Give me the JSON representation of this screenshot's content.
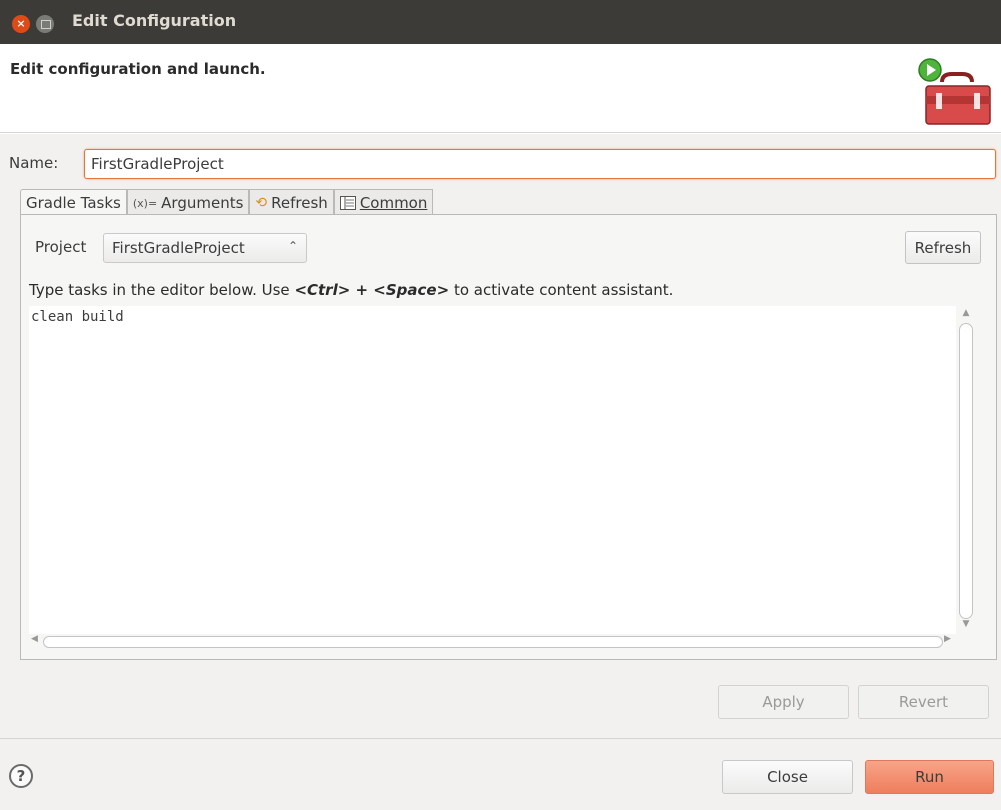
{
  "window": {
    "title": "Edit Configuration"
  },
  "header": {
    "message": "Edit configuration and launch."
  },
  "name": {
    "label": "Name:",
    "value": "FirstGradleProject"
  },
  "tabs": [
    {
      "label": "Gradle Tasks",
      "icon": ""
    },
    {
      "label": "Arguments",
      "icon": "(x)="
    },
    {
      "label": "Refresh",
      "icon": "refresh-icon"
    },
    {
      "label": "Common",
      "icon": "common-icon"
    }
  ],
  "project": {
    "label": "Project",
    "selected": "FirstGradleProject",
    "refresh_label": "Refresh"
  },
  "hint": {
    "prefix": "Type tasks in the editor below. Use ",
    "keys": "<Ctrl> + <Space>",
    "suffix": " to activate content assistant."
  },
  "editor": {
    "content": "clean build"
  },
  "buttons": {
    "apply": "Apply",
    "revert": "Revert",
    "close": "Close",
    "run": "Run"
  },
  "colors": {
    "accent": "#ee7e5c",
    "titlebar": "#3c3b37"
  }
}
